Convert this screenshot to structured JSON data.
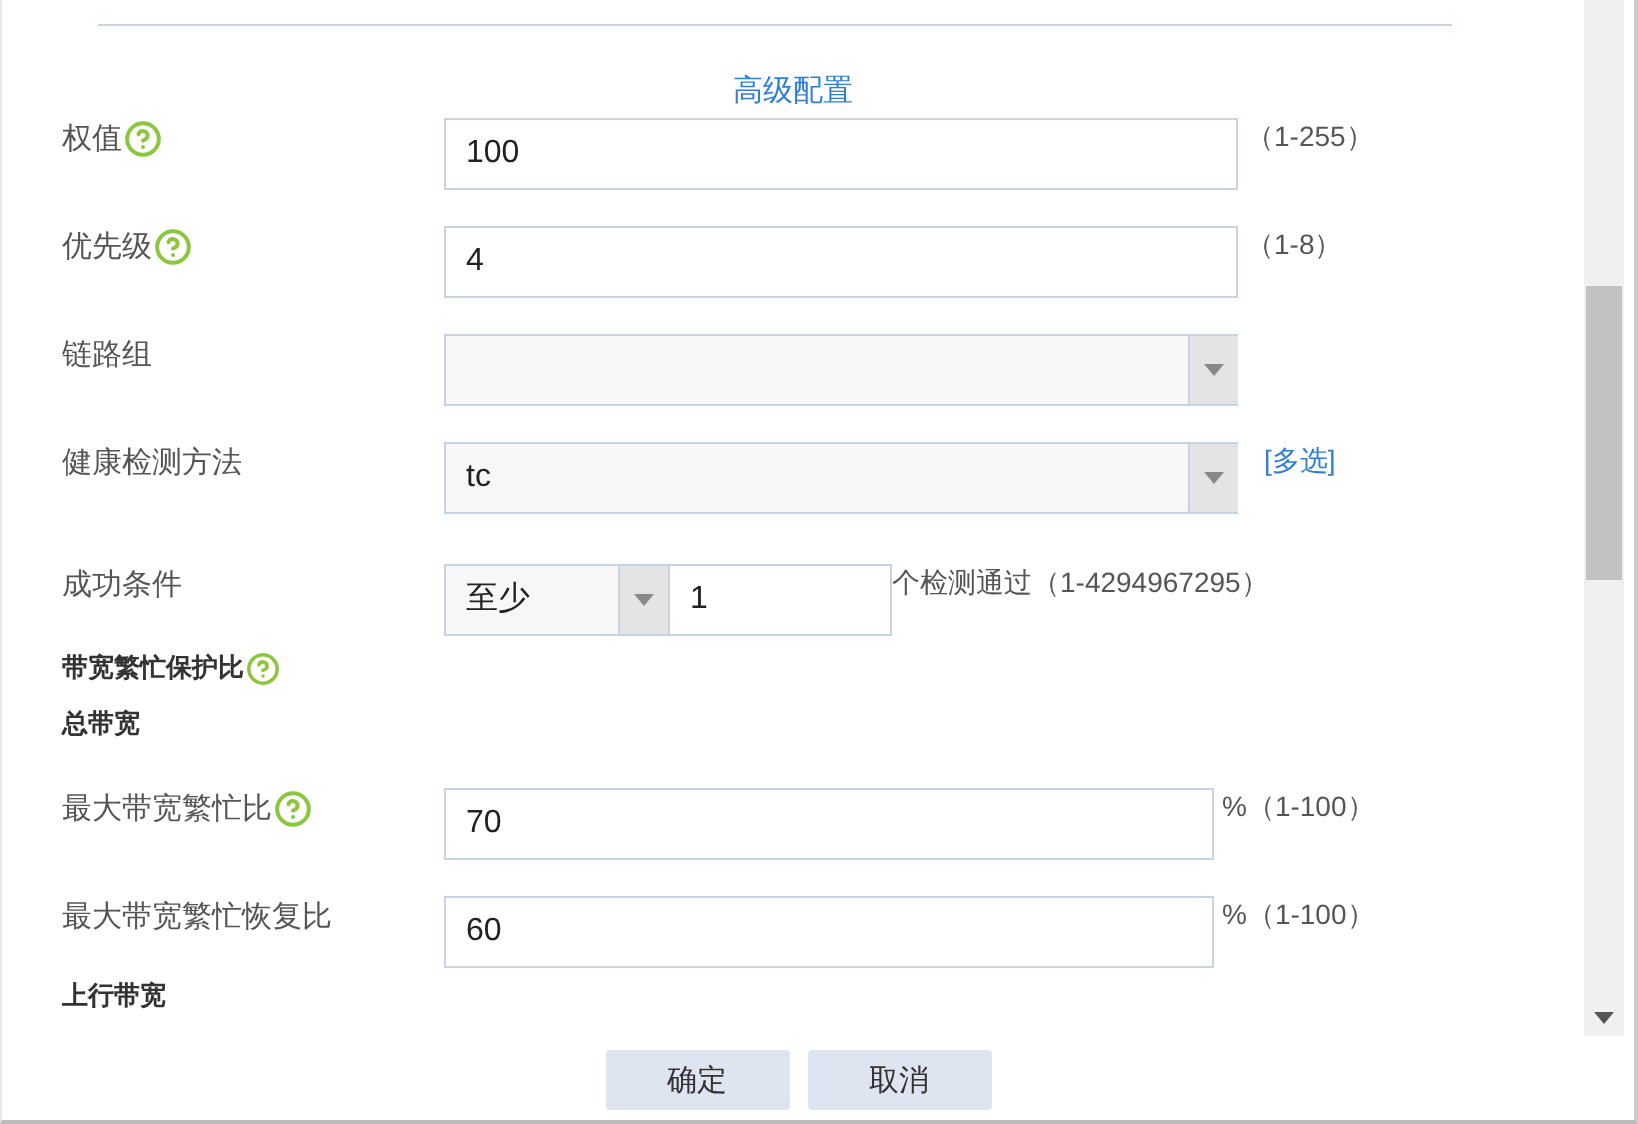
{
  "section_title": "高级配置",
  "fields": [
    {
      "kind": "text",
      "label": "权值",
      "help": true,
      "value": "100",
      "hint": "（1-255）"
    },
    {
      "kind": "text",
      "label": "优先级",
      "help": true,
      "value": "4",
      "hint": "（1-8）"
    },
    {
      "kind": "select",
      "label": "链路组",
      "help": false
    },
    {
      "kind": "select",
      "label": "健康检测方法",
      "help": false,
      "value": "tc",
      "link": "[多选]"
    },
    {
      "kind": "count",
      "label": "成功条件",
      "help": false,
      "select_value": "至少",
      "value": "1",
      "hint": "个检测通过（1-4294967295）"
    },
    {
      "kind": "heading",
      "label": "带宽繁忙保护比",
      "help": true
    },
    {
      "kind": "heading",
      "label": "总带宽",
      "help": false
    },
    {
      "kind": "text",
      "label": "最大带宽繁忙比",
      "help": true,
      "value": "70",
      "hint": "%（1-100）",
      "short": true
    },
    {
      "kind": "text",
      "label": "最大带宽繁忙恢复比",
      "help": false,
      "value": "60",
      "hint": "%（1-100）",
      "short": true
    },
    {
      "kind": "heading",
      "label": "上行带宽",
      "help": false
    }
  ],
  "buttons": [
    "确定",
    "取消"
  ]
}
